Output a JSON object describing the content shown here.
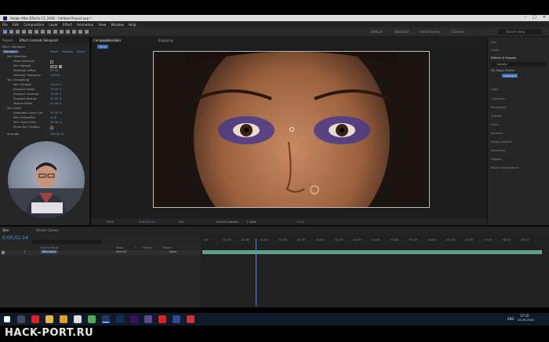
{
  "window": {
    "title": "Adobe After Effects CC 2018 - Untitled Project.aep *"
  },
  "menu": [
    "File",
    "Edit",
    "Composition",
    "Layer",
    "Effect",
    "Animation",
    "View",
    "Window",
    "Help"
  ],
  "toolbar": {
    "workspaces": [
      "Default",
      "Standard",
      "Small Screen",
      "Libraries"
    ],
    "search_placeholder": "Search Help"
  },
  "left_panel": {
    "tabs": [
      "Project",
      "Effect Controls Skinpaint"
    ],
    "layer_label": "Skin • Skinpaint",
    "effect_name": "Skinpaint",
    "effect_links": [
      "Reset",
      "Register",
      "About"
    ],
    "rows": [
      {
        "label": "Skin Selection",
        "value": ""
      },
      {
        "label": "Show Selection",
        "value": ""
      },
      {
        "label": "Skin Sample",
        "value": ""
      },
      {
        "label": "Selection Offset",
        "value": "20.00"
      },
      {
        "label": "Selection Tolerance",
        "value": "100.00"
      },
      {
        "label": "Skin Smoothing",
        "value": ""
      },
      {
        "label": "Skin Smooth",
        "value": "100.0 %"
      },
      {
        "label": "Preserve Detail",
        "value": "70.00 %"
      },
      {
        "label": "Preserve Contrast",
        "value": "15.00 %"
      },
      {
        "label": "Sharpen Texture",
        "value": "25.00 %"
      },
      {
        "label": "Texture Noise",
        "value": "20.00 %"
      },
      {
        "label": "Skin Color",
        "value": ""
      },
      {
        "label": "Automatic Color Corr",
        "value": "70.00 %"
      },
      {
        "label": "Skin Yellow/Pink",
        "value": "0.00"
      },
      {
        "label": "Skin Color Unify",
        "value": "20.00 %"
      },
      {
        "label": "Show Skin Overlay",
        "value": ""
      },
      {
        "label": "Strength",
        "value": "100.00 %"
      }
    ]
  },
  "comp": {
    "tabs": [
      "Composition Skin",
      "Layer (none)"
    ],
    "subtab": "Skin",
    "snapping_label": "Snapping",
    "bottom": {
      "zoom": "50%",
      "timecode": "0;00;01;14",
      "resolution": "Full",
      "camera": "Active Camera",
      "views": "1 View",
      "offset": "+0.0"
    }
  },
  "right_panel": {
    "items": [
      "Info",
      "Audio",
      "Effects & Presets",
      "Align",
      "Character",
      "Paragraph",
      "Tracker",
      "Paint",
      "Brushes",
      "Motion Sketch",
      "Smoother",
      "Wiggler",
      "Mask Interpolation"
    ],
    "search_value": "beauty",
    "fx_group": "RG Magic Bullet",
    "fx_item": "Cosmo II"
  },
  "timeline": {
    "tab": "Skin",
    "render_queue": "Render Queue",
    "timecode": "0;00;01;14",
    "columns": [
      "Source Name",
      "Mode",
      "T",
      "TrkMat",
      "Parent"
    ],
    "layer": {
      "num": "1",
      "name": "Skin.mp4",
      "mode": "Normal",
      "parent": "None"
    },
    "ruler": [
      "00f",
      "00:15f",
      "01:00f",
      "01:15f",
      "02:00f",
      "02:15f",
      "03:00f",
      "03:15f",
      "04:00f",
      "04:15f",
      "05:00f",
      "05:15f",
      "06:00f",
      "06:15f",
      "07:00f",
      "07:15f",
      "08:00f",
      "08:15f"
    ]
  },
  "taskbar": {
    "language": "ENG",
    "time": "17:22",
    "date": "24.09.2018"
  },
  "watermark": "HACK-PORT.RU"
}
